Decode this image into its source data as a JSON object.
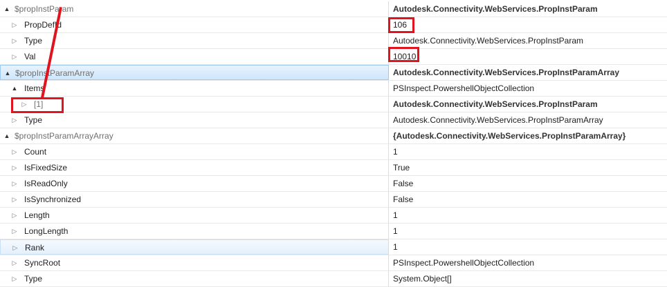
{
  "rows": [
    {
      "arrow": "▲",
      "name": "$propInstParam",
      "value": "Autodesk.Connectivity.WebServices.PropInstParam"
    },
    {
      "arrow": "▷",
      "name": "PropDefId",
      "value": "106"
    },
    {
      "arrow": "▷",
      "name": "Type",
      "value": "Autodesk.Connectivity.WebServices.PropInstParam"
    },
    {
      "arrow": "▷",
      "name": "Val",
      "value": "10010"
    },
    {
      "arrow": "▲",
      "name": "$propInstParamArray",
      "value": "Autodesk.Connectivity.WebServices.PropInstParamArray"
    },
    {
      "arrow": "▲",
      "name": "Items",
      "value": "PSInspect.PowershellObjectCollection"
    },
    {
      "arrow": "▷",
      "name": "[1]",
      "value": "Autodesk.Connectivity.WebServices.PropInstParam"
    },
    {
      "arrow": "▷",
      "name": "Type",
      "value": "Autodesk.Connectivity.WebServices.PropInstParamArray"
    },
    {
      "arrow": "▲",
      "name": "$propInstParamArrayArray",
      "value": "{Autodesk.Connectivity.WebServices.PropInstParamArray}"
    },
    {
      "arrow": "▷",
      "name": "Count",
      "value": "1"
    },
    {
      "arrow": "▷",
      "name": "IsFixedSize",
      "value": "True"
    },
    {
      "arrow": "▷",
      "name": "IsReadOnly",
      "value": "False"
    },
    {
      "arrow": "▷",
      "name": "IsSynchronized",
      "value": "False"
    },
    {
      "arrow": "▷",
      "name": "Length",
      "value": "1"
    },
    {
      "arrow": "▷",
      "name": "LongLength",
      "value": "1"
    },
    {
      "arrow": "▷",
      "name": "Rank",
      "value": "1"
    },
    {
      "arrow": "▷",
      "name": "SyncRoot",
      "value": "PSInspect.PowershellObjectCollection"
    },
    {
      "arrow": "▷",
      "name": "Type",
      "value": "System.Object[]"
    }
  ],
  "colors": {
    "annotation": "#e0141e",
    "selection": "#cfe6fb"
  }
}
